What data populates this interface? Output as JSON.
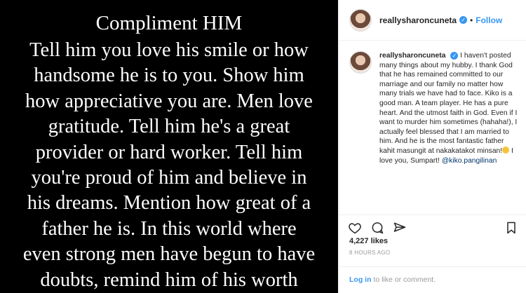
{
  "image": {
    "heading": "Compliment HIM",
    "lines": [
      "Tell him you love his smile or how",
      "handsome he is to you. Show him",
      "how appreciative you are. Men love",
      "gratitude. Tell him he's a great",
      "provider or hard worker. Tell him",
      "you're proud of him and believe in",
      "his dreams. Mention how great of a",
      "father he is. In this world where",
      "even strong men have begun to have",
      "doubts, remind him of his worth"
    ]
  },
  "header": {
    "username": "reallysharoncuneta",
    "verified_glyph": "✓",
    "separator": "•",
    "follow_label": "Follow"
  },
  "caption": {
    "username": "reallysharoncuneta",
    "text_a": " I haven't posted many things about my hubby. I thank God that he has remained committed to our marriage and our family no matter how many trials we have had to face. Kiko is a good man. A team player. He has a pure heart. And the utmost faith in God. Even if I want to murder him sometimes (hahaha!), I actually feel blessed that I am married to him. And he is the most fantastic father kahit masungit at nakakatakot minsan!",
    "text_b": " I love you, Sumpart! ",
    "mention": "@kiko.pangilinan"
  },
  "icons": {
    "like": "heart-icon",
    "comment": "comment-icon",
    "share": "share-icon",
    "save": "bookmark-icon",
    "emoji": "grimacing-face-emoji"
  },
  "likes": "4,227 likes",
  "timestamp": "8 HOURS AGO",
  "footer": {
    "login_label": "Log in",
    "rest": " to like or comment."
  },
  "colors": {
    "accent": "#3897f0",
    "mention": "#003569"
  }
}
